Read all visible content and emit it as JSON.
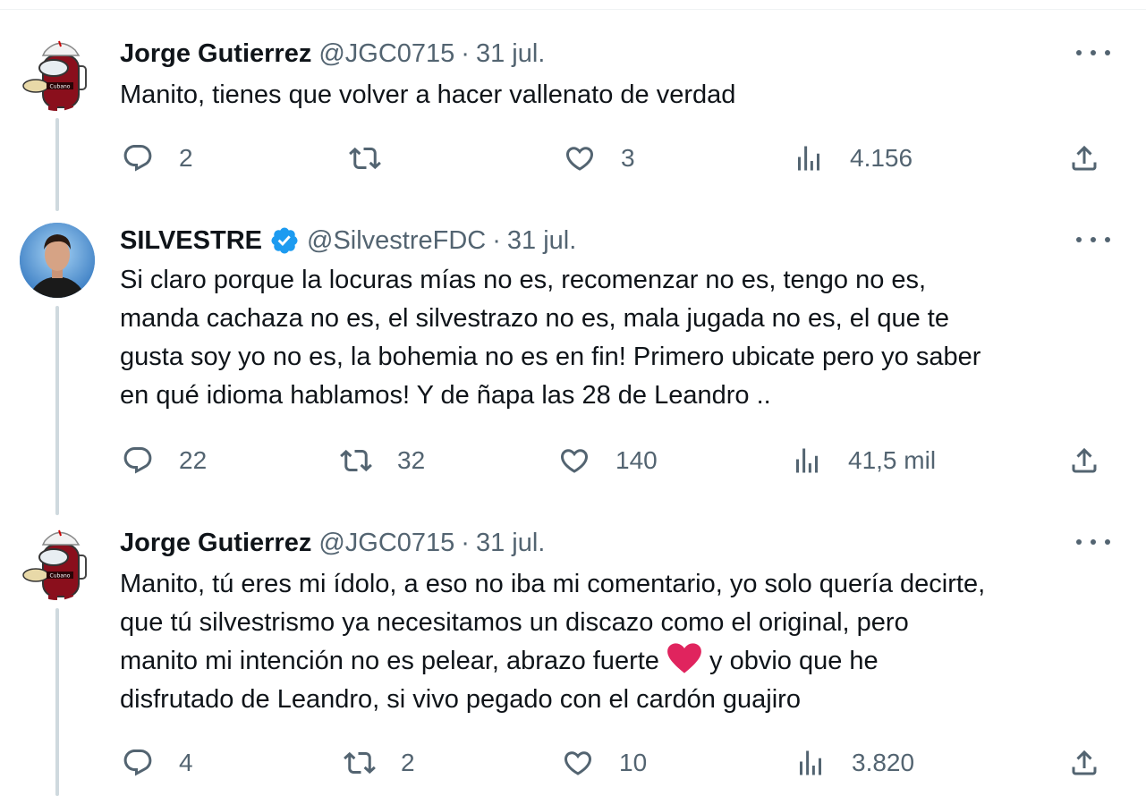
{
  "tweets": [
    {
      "name": "Jorge Gutierrez",
      "handle": "@JGC0715",
      "separator": "·",
      "date": "31 jul.",
      "verified": false,
      "text": "Manito, tienes que volver a hacer vallenato de verdad",
      "replies": "2",
      "retweets": "",
      "likes": "3",
      "views": "4.156"
    },
    {
      "name": "SILVESTRE",
      "handle": "@SilvestreFDC",
      "separator": "·",
      "date": "31 jul.",
      "verified": true,
      "text": "Si claro porque la locuras mías no es, recomenzar no es, tengo no es,\nmanda cachaza no es, el silvestrazo no es, mala jugada no es, el que te\ngusta soy yo no es, la bohemia no es en fin! Primero ubicate pero yo saber\nen qué idioma hablamos! Y de ñapa las 28 de Leandro ..",
      "replies": "22",
      "retweets": "32",
      "likes": "140",
      "views": "41,5 mil"
    },
    {
      "name": "Jorge Gutierrez",
      "handle": "@JGC0715",
      "separator": "·",
      "date": "31 jul.",
      "verified": false,
      "text_line1": "Manito, tú eres mi ídolo, a eso no iba mi comentario, yo solo quería decirte,",
      "text_line2": "que tú silvestrismo ya necesitamos un discazo como el original, pero",
      "text_line3a": "manito mi intención no es pelear, abrazo fuerte ",
      "text_line3b": " y obvio que he",
      "text_line4": "disfrutado de Leandro, si vivo pegado con el cardón guajiro",
      "replies": "4",
      "retweets": "2",
      "likes": "10",
      "views": "3.820"
    }
  ],
  "colors": {
    "text": "#0f1419",
    "secondary": "#536471",
    "verified": "#1d9bf0",
    "thread_line": "#cfd9de",
    "heart_emoji": "#e0245e"
  },
  "icons": {
    "reply": "speech-bubble-icon",
    "retweet": "retweet-icon",
    "like": "heart-outline-icon",
    "views": "bar-chart-icon",
    "share": "share-upload-icon",
    "more": "three-dots-icon"
  }
}
